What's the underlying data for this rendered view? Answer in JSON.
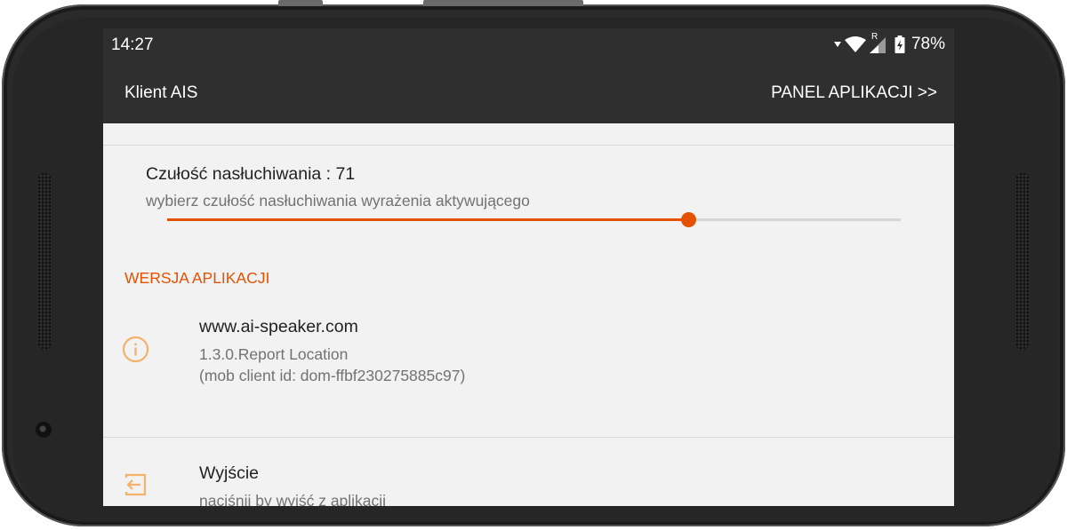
{
  "status_bar": {
    "time": "14:27",
    "battery_percent": "78%",
    "icons": [
      "signal-arrow-icon",
      "wifi-icon",
      "roaming-signal-icon",
      "battery-charging-icon"
    ],
    "roaming_letter": "R"
  },
  "toolbar": {
    "title": "Klient AIS",
    "action_label": "PANEL APLIKACJI >>"
  },
  "sensitivity": {
    "title": "Czułość nasłuchiwania : 71",
    "summary": "wybierz czułość nasłuchiwania wyrażenia aktywującego",
    "value_fraction": 0.71
  },
  "version_section": {
    "header": "WERSJA APLIKACJI",
    "title": "www.ai-speaker.com",
    "line1": "1.3.0.Report Location",
    "line2": "(mob client id: dom-ffbf230275885c97)",
    "icon": "info-icon"
  },
  "exit": {
    "title": "Wyjście",
    "summary": "naciśnij by wyjść z aplikacji",
    "icon": "exit-icon"
  },
  "colors": {
    "accent": "#e65100",
    "icon_tint": "#f5b26b",
    "toolbar_bg": "#2f2f2f",
    "content_bg": "#f2f2f2"
  }
}
